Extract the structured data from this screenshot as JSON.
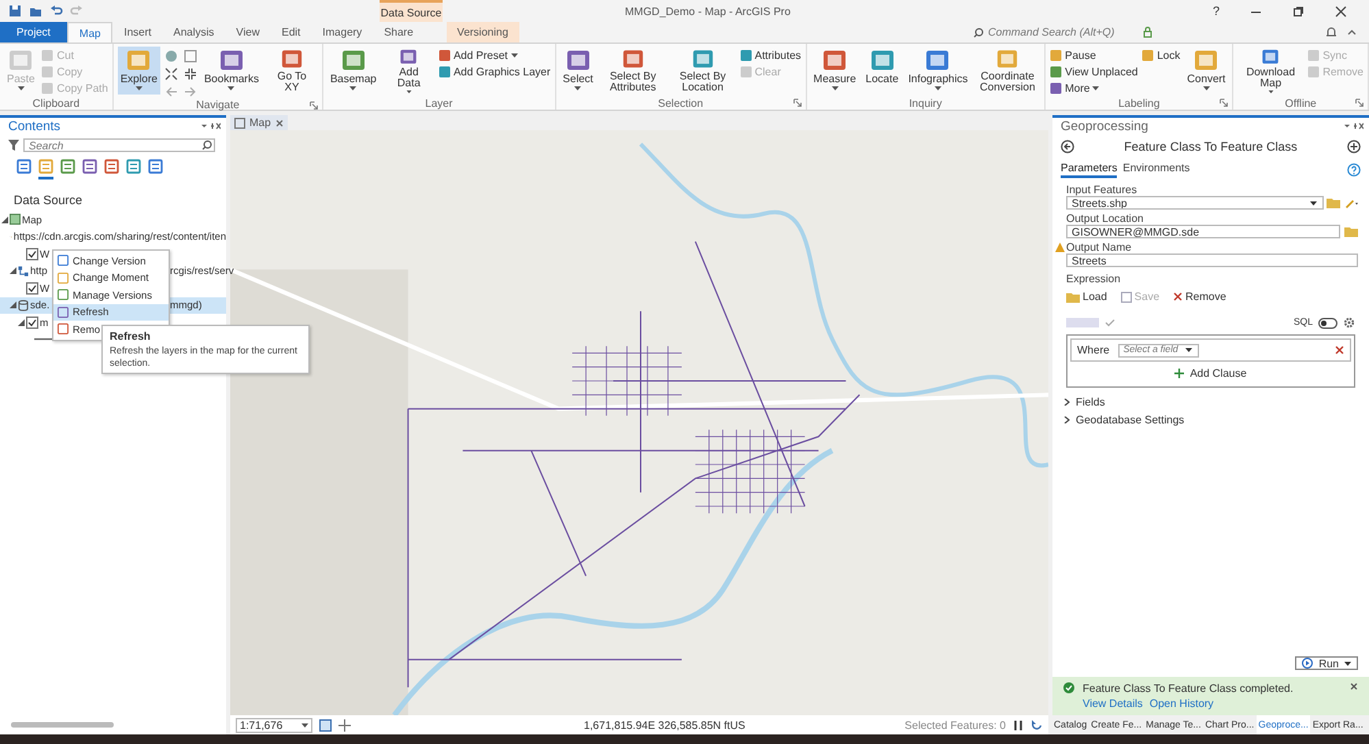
{
  "window": {
    "title": "MMGD_Demo - Map - ArcGIS Pro",
    "help": "?"
  },
  "ribbon": {
    "contextual_label": "Data Source",
    "tabs": [
      {
        "label": "Project",
        "kind": "backstage",
        "selected": false
      },
      {
        "label": "Map",
        "kind": "core",
        "selected": true
      },
      {
        "label": "Insert",
        "kind": "core",
        "selected": false
      },
      {
        "label": "Analysis",
        "kind": "core",
        "selected": false
      },
      {
        "label": "View",
        "kind": "core",
        "selected": false
      },
      {
        "label": "Edit",
        "kind": "core",
        "selected": false
      },
      {
        "label": "Imagery",
        "kind": "core",
        "selected": false
      },
      {
        "label": "Share",
        "kind": "core",
        "selected": false
      },
      {
        "label": "Versioning",
        "kind": "contextual",
        "selected": false
      }
    ],
    "search": {
      "placeholder": "Command Search (Alt+Q)"
    },
    "groups": [
      {
        "label": "Clipboard",
        "launcher": false,
        "items": [
          {
            "kind": "large",
            "label": "Paste",
            "disabled": true,
            "active": false,
            "dropdown": true
          },
          {
            "kind": "stack",
            "items": [
              {
                "label": "Cut",
                "disabled": true,
                "dropdown": false
              },
              {
                "label": "Copy",
                "disabled": true,
                "dropdown": false
              },
              {
                "label": "Copy Path",
                "disabled": true,
                "dropdown": false
              }
            ]
          }
        ]
      },
      {
        "label": "Navigate",
        "launcher": true,
        "items": [
          {
            "kind": "large",
            "label": "Explore",
            "disabled": false,
            "active": true,
            "dropdown": true
          },
          {
            "kind": "nav"
          },
          {
            "kind": "large",
            "label": "Bookmarks",
            "disabled": false,
            "active": false,
            "dropdown": true
          },
          {
            "kind": "large",
            "label": "Go To XY",
            "disabled": false,
            "active": false,
            "dropdown": false
          }
        ]
      },
      {
        "label": "Layer",
        "launcher": false,
        "items": [
          {
            "kind": "large",
            "label": "Basemap",
            "disabled": false,
            "active": false,
            "dropdown": true
          },
          {
            "kind": "large",
            "label": "Add Data",
            "disabled": false,
            "active": false,
            "dropdown": true
          },
          {
            "kind": "stack",
            "items": [
              {
                "label": "Add Preset",
                "disabled": false,
                "dropdown": true
              },
              {
                "label": "Add Graphics Layer",
                "disabled": false,
                "dropdown": false
              }
            ]
          }
        ]
      },
      {
        "label": "Selection",
        "launcher": true,
        "items": [
          {
            "kind": "large",
            "label": "Select",
            "disabled": false,
            "active": false,
            "dropdown": true
          },
          {
            "kind": "large",
            "label": "Select By Attributes",
            "disabled": false,
            "active": false,
            "dropdown": false
          },
          {
            "kind": "large",
            "label": "Select By Location",
            "disabled": false,
            "active": false,
            "dropdown": false
          },
          {
            "kind": "stack",
            "items": [
              {
                "label": "Attributes",
                "disabled": false,
                "dropdown": false
              },
              {
                "label": "Clear",
                "disabled": true,
                "dropdown": false
              }
            ]
          }
        ]
      },
      {
        "label": "Inquiry",
        "launcher": false,
        "items": [
          {
            "kind": "large",
            "label": "Measure",
            "disabled": false,
            "active": false,
            "dropdown": true
          },
          {
            "kind": "large",
            "label": "Locate",
            "disabled": false,
            "active": false,
            "dropdown": false
          },
          {
            "kind": "large",
            "label": "Infographics",
            "disabled": false,
            "active": false,
            "dropdown": true
          },
          {
            "kind": "large",
            "label": "Coordinate Conversion",
            "disabled": false,
            "active": false,
            "dropdown": false
          }
        ]
      },
      {
        "label": "Labeling",
        "launcher": true,
        "items": [
          {
            "kind": "stack",
            "items": [
              {
                "label": "Pause",
                "disabled": false,
                "dropdown": false
              },
              {
                "label": "View Unplaced",
                "disabled": false,
                "dropdown": false
              },
              {
                "label": "More",
                "disabled": false,
                "dropdown": true
              }
            ]
          },
          {
            "kind": "stack",
            "items": [
              {
                "label": "Lock",
                "disabled": false,
                "dropdown": false
              }
            ]
          },
          {
            "kind": "large",
            "label": "Convert",
            "disabled": false,
            "active": false,
            "dropdown": true
          }
        ]
      },
      {
        "label": "Offline",
        "launcher": true,
        "items": [
          {
            "kind": "large",
            "label": "Download Map",
            "disabled": false,
            "active": false,
            "dropdown": true
          },
          {
            "kind": "stack",
            "items": [
              {
                "label": "Sync",
                "disabled": true,
                "dropdown": false
              },
              {
                "label": "Remove",
                "disabled": true,
                "dropdown": false
              }
            ]
          }
        ]
      }
    ]
  },
  "contents": {
    "title": "Contents",
    "search": {
      "placeholder": "Search"
    },
    "view_tabs": [
      {
        "selected": false
      },
      {
        "selected": true
      },
      {
        "selected": false
      },
      {
        "selected": false
      },
      {
        "selected": false
      },
      {
        "selected": false
      },
      {
        "selected": false
      }
    ],
    "heading": "Data Source",
    "tree": [
      {
        "kind": "map",
        "label": "Map",
        "expanded": true,
        "selected": false,
        "children": [
          {
            "kind": "source",
            "label": "https://cdn.arcgis.com/sharing/rest/content/iten",
            "expanded": true,
            "selected": false,
            "children": [
              {
                "label": "W",
                "checked": true,
                "selected": false
              }
            ]
          },
          {
            "kind": "service",
            "label": "http",
            "tail": "rcgis/rest/serv",
            "expanded": true,
            "selected": false,
            "children": [
              {
                "label": "W",
                "checked": true,
                "selected": false
              }
            ]
          },
          {
            "kind": "database",
            "label": "sde.",
            "tail": "mmgd)",
            "expanded": true,
            "selected": true,
            "children": [
              {
                "label": "m",
                "checked": true,
                "expanded": true,
                "selected": false,
                "children": [
                  {
                    "kind": "symbol",
                    "selected": false
                  }
                ]
              }
            ]
          }
        ]
      }
    ]
  },
  "context_menu": {
    "items": [
      {
        "label": "Change Version",
        "selected": false
      },
      {
        "label": "Change Moment",
        "selected": false
      },
      {
        "label": "Manage Versions",
        "selected": false
      },
      {
        "label": "Refresh",
        "selected": true
      },
      {
        "label": "Remo",
        "selected": false
      }
    ]
  },
  "tooltip": {
    "title": "Refresh",
    "text": "Refresh the layers in the map for the current selection."
  },
  "map_view": {
    "tab": {
      "label": "Map",
      "selected": true
    },
    "scale": "1:71,676",
    "coordinates": "1,671,815.94E 326,585.85N ftUS",
    "selected_features": "Selected Features: 0"
  },
  "geoprocessing": {
    "title": "Geoprocessing",
    "tool": "Feature Class To Feature Class",
    "tabs": [
      {
        "label": "Parameters",
        "selected": true
      },
      {
        "label": "Environments",
        "selected": false
      }
    ],
    "params": [
      {
        "label": "Input Features",
        "value": "Streets.shp",
        "kind": "dropdown",
        "warning": false
      },
      {
        "label": "Output Location",
        "value": "GISOWNER@MMGD.sde",
        "kind": "workspace",
        "warning": false
      },
      {
        "label": "Output Name",
        "value": "Streets",
        "kind": "text",
        "warning": true
      }
    ],
    "expression": {
      "label": "Expression",
      "actions": [
        {
          "label": "Load",
          "kind": "load",
          "disabled": false
        },
        {
          "label": "Save",
          "kind": "save",
          "disabled": true
        },
        {
          "label": "Remove",
          "kind": "remove",
          "disabled": false
        }
      ],
      "sql_label": "SQL",
      "sql_on": false,
      "where": "Where",
      "field_placeholder": "Select a field",
      "add_clause": "Add Clause"
    },
    "sections": [
      {
        "label": "Fields",
        "expanded": false
      },
      {
        "label": "Geodatabase Settings",
        "expanded": false
      }
    ],
    "run": "Run",
    "notification": {
      "message": "Feature Class To Feature Class completed.",
      "links": [
        "View Details",
        "Open History"
      ]
    }
  },
  "bottom_tabs": [
    {
      "label": "Catalog",
      "selected": false
    },
    {
      "label": "Create Fe...",
      "selected": false
    },
    {
      "label": "Manage Te...",
      "selected": false
    },
    {
      "label": "Chart Pro...",
      "selected": false
    },
    {
      "label": "Geoproce...",
      "selected": true
    },
    {
      "label": "Export Ra...",
      "selected": false
    }
  ]
}
